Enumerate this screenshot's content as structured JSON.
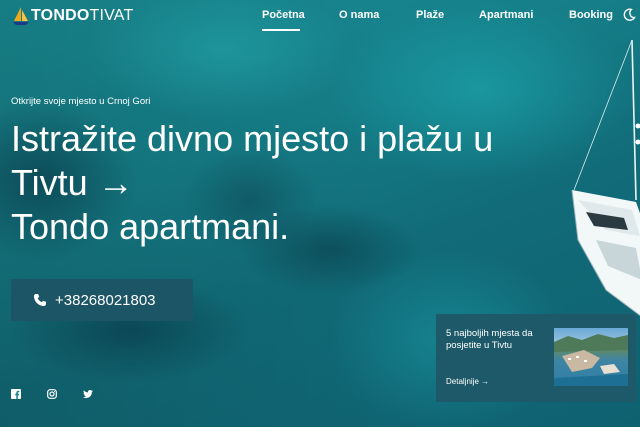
{
  "brand": {
    "name_bold": "TONDO",
    "name_light": "TIVAT"
  },
  "nav": {
    "items": [
      {
        "label": "Početna",
        "active": true
      },
      {
        "label": "O nama"
      },
      {
        "label": "Plaže"
      },
      {
        "label": "Apartmani"
      },
      {
        "label": "Booking"
      }
    ]
  },
  "hero": {
    "tagline": "Otkrijte svoje mjesto u Crnoj Gori",
    "headline_lines": [
      "Istražite divno mjesto i plažu u",
      "Tivtu →",
      "Tondo apartmani."
    ],
    "phone": "+38268021803"
  },
  "social": [
    "facebook-icon",
    "instagram-icon",
    "twitter-icon"
  ],
  "card": {
    "title": "5 najboljih mjesta da posjetite u Tivtu",
    "link": "Detaljnije →"
  },
  "colors": {
    "water": "#157d87",
    "panel": "#1b5566",
    "text": "#ffffff"
  }
}
